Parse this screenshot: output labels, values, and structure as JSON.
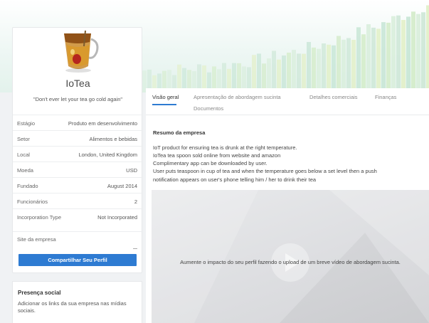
{
  "company": {
    "name": "IoTea",
    "tagline": "\"Don't ever let your tea go cold again\""
  },
  "info": [
    {
      "label": "Estágio",
      "value": "Produto em desenvolvimento"
    },
    {
      "label": "Setor",
      "value": "Alimentos e bebidas"
    },
    {
      "label": "Local",
      "value": "London, United Kingdom"
    },
    {
      "label": "Moeda",
      "value": "USD"
    },
    {
      "label": "Fundado",
      "value": "August 2014"
    },
    {
      "label": "Funcionários",
      "value": "2"
    },
    {
      "label": "Incorporation Type",
      "value": "Not Incorporated"
    }
  ],
  "site_label": "Site da empresa",
  "share_button": "Compartilhar Seu Perfil",
  "social": {
    "title": "Presença social",
    "text": "Adicionar os links da sua empresa nas mídias sociais."
  },
  "tabs": {
    "t1": "Visão geral",
    "t2": "Apresentação de abordagem sucinta",
    "t3": "Detalhes comerciais",
    "t4": "Finanças",
    "t5": "Documentos"
  },
  "summary": {
    "title": "Resumo da empresa",
    "lines": [
      "IoT product for ensuring tea is drunk at the right temperature.",
      "IoTea tea spoon sold online from website and amazon",
      "Complimentary app can be downloaded by user.",
      "User puts teaspoon in cup of tea and when the temperature goes below a set level then a push",
      "notification appears on user's phone telling him / her to drink their tea"
    ]
  },
  "video_text": "Aumente o impacto do seu perfil fazendo o upload de um breve vídeo de abordagem sucinta.",
  "colors": {
    "accent": "#2e7bd2",
    "banner_bars": [
      "#d9eedc",
      "#cfe8d8",
      "#e2f0c8",
      "#c8e6d6",
      "#d4ecca"
    ]
  },
  "icons": {
    "logo": "tea-cup-logo",
    "play": "play-icon"
  }
}
